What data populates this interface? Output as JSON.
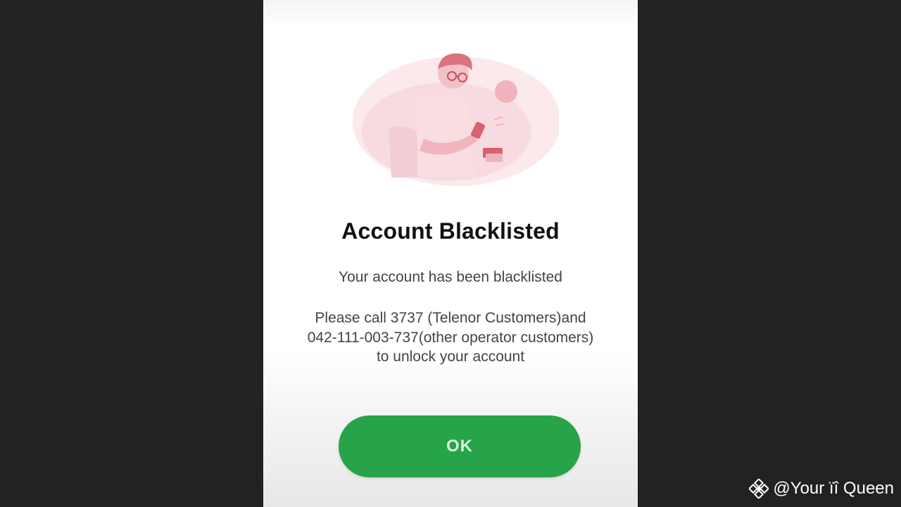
{
  "dialog": {
    "title": "Account Blacklisted",
    "subtitle": "Your account has been blacklisted",
    "instructions": [
      "Please call 3737 (Telenor Customers)and",
      "042-111-003-737(other operator customers)",
      "to unlock your account"
    ],
    "ok_label": "OK",
    "illustration_icon": "person-holding-card-illustration"
  },
  "watermark": {
    "text": "@Your ïî Queen",
    "icon": "binance-logo-icon"
  },
  "colors": {
    "button_green": "#27a34a",
    "button_text": "#d8f3dc",
    "illustration_pink": "#e8a0a8",
    "background_dark": "#222222"
  }
}
